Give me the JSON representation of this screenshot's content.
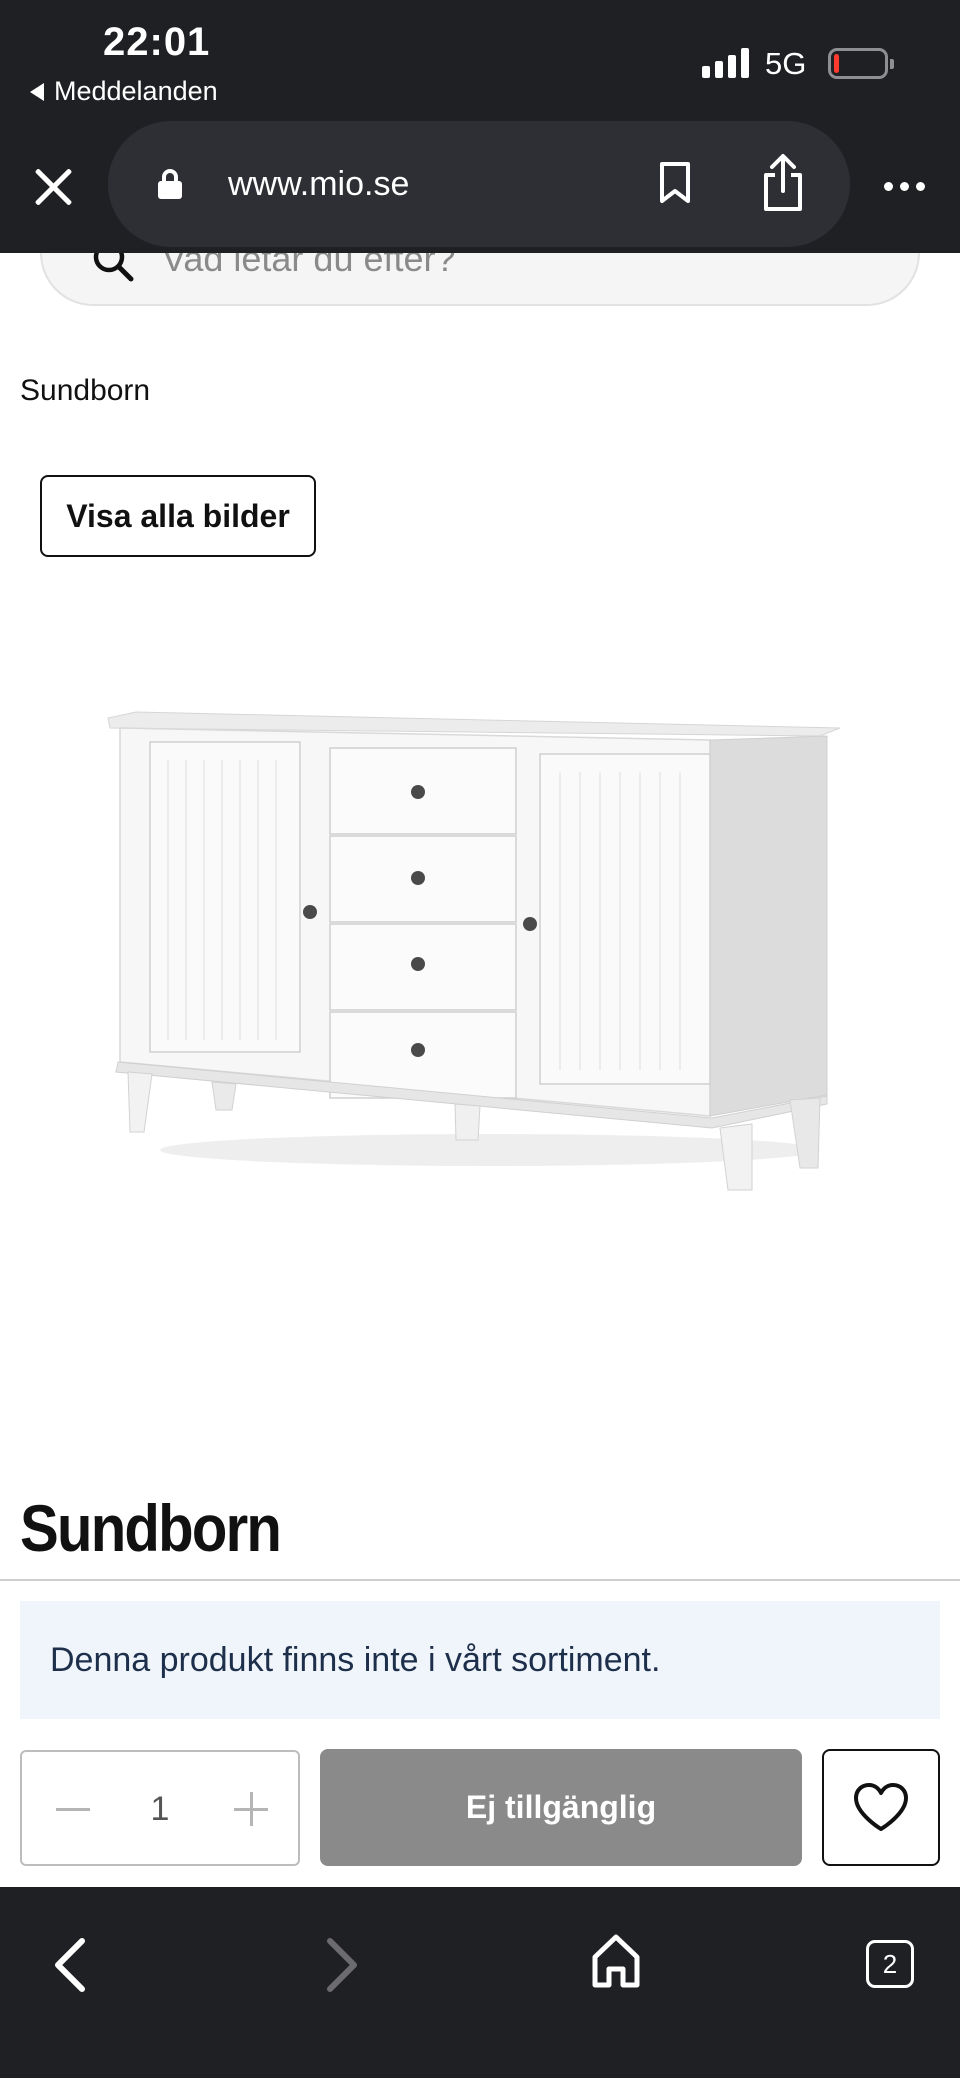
{
  "status_bar": {
    "time": "22:01",
    "back_app": "Meddelanden",
    "network": "5G",
    "signal_bars": 4,
    "battery_level": 0.1
  },
  "browser": {
    "url": "www.mio.se",
    "tab_count": "2",
    "icons": [
      "close-icon",
      "lock-icon",
      "bookmark-icon",
      "share-icon",
      "more-icon",
      "back-icon",
      "forward-icon",
      "home-icon",
      "tabs-icon"
    ]
  },
  "search": {
    "placeholder": "Vad letar du efter?"
  },
  "breadcrumb": "Sundborn",
  "gallery": {
    "show_all_label": "Visa alla bilder"
  },
  "product": {
    "title": "Sundborn",
    "notice": "Denna produkt finns inte i vårt sortiment.",
    "quantity": "1",
    "buy_label": "Ej tillgänglig"
  },
  "colors": {
    "browser_chrome": "#1f2024",
    "notice_bg": "#eff5fa",
    "disabled_button": "#8a8a8a"
  }
}
